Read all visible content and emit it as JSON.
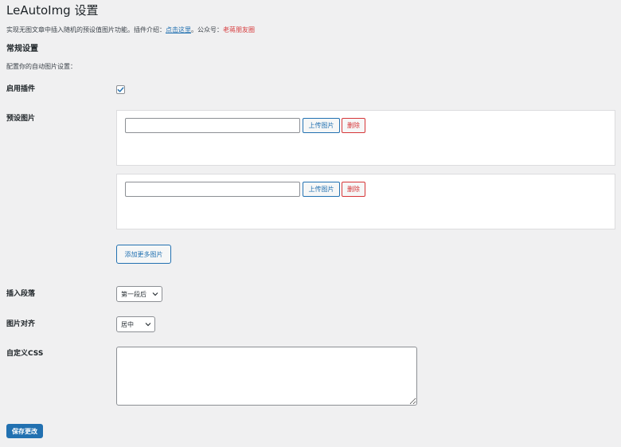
{
  "page": {
    "title": "LeAutoImg 设置",
    "intro_text": "实现无图文章中插入随机的预设值图片功能。插件介绍：",
    "intro_link": "点击这里",
    "intro_after_link": "。公众号：",
    "intro_account": "老蒋朋友圈"
  },
  "section": {
    "title": "常规设置",
    "description": "配置你的自动图片设置："
  },
  "fields": {
    "enable_label": "启用插件",
    "enable_checked": true,
    "images_label": "预设图片",
    "image_rows": [
      {
        "value": "",
        "upload_label": "上传图片",
        "delete_label": "删除"
      },
      {
        "value": "",
        "upload_label": "上传图片",
        "delete_label": "删除"
      }
    ],
    "add_more_label": "添加更多图片",
    "paragraph_label": "插入段落",
    "paragraph_selected": "第一段后",
    "align_label": "图片对齐",
    "align_selected": "居中",
    "custom_css_label": "自定义CSS",
    "custom_css_value": ""
  },
  "actions": {
    "save_label": "保存更改"
  },
  "colors": {
    "accent": "#2271b1",
    "danger": "#d63638",
    "background": "#f0f0f1"
  }
}
